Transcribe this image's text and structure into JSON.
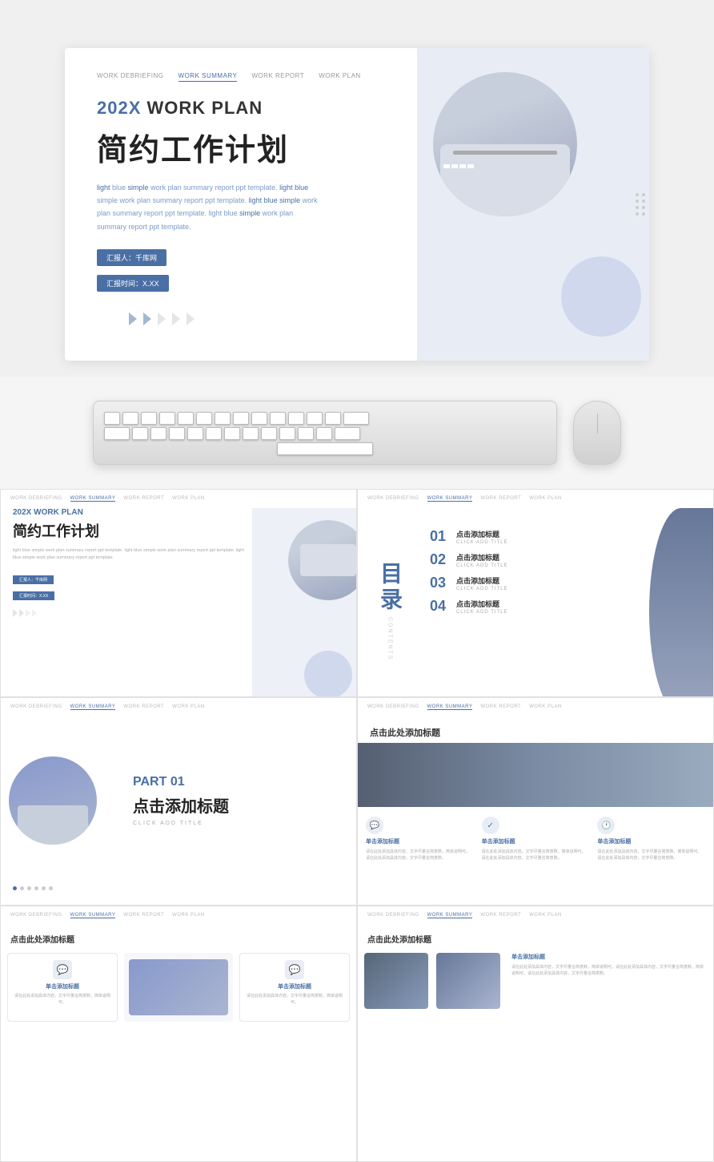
{
  "hero": {
    "nav": {
      "items": [
        "WORK DEBRIEFING",
        "WORK SUMMARY",
        "WORK REPORT",
        "WORK PLAN"
      ],
      "active": "WORK SUMMARY"
    },
    "title_en_prefix": "202X",
    "title_en_suffix": "WORK PLAN",
    "title_zh": "简约工作计划",
    "desc": "light blue simple work plan summary report ppt template. light blue simple work plan summary report ppt template. light blue simple work plan summary report ppt template. light blue simple work plan summary report ppt template.",
    "reporter_label": "汇报人：千库网",
    "time_label": "汇报时间：X.XX"
  },
  "toc": {
    "title_zh": "目录",
    "title_en": "CONTENTS",
    "items": [
      {
        "num": "01",
        "title": "点击添加标题",
        "sub": "CLICK ADD TITLE"
      },
      {
        "num": "02",
        "title": "点击添加标题",
        "sub": "CLICK ADD TITLE"
      },
      {
        "num": "03",
        "title": "点击添加标题",
        "sub": "CLICK ADD TITLE"
      },
      {
        "num": "04",
        "title": "点击添加标题",
        "sub": "CLICK ADD TITLE"
      }
    ]
  },
  "part": {
    "label": "PART 01",
    "title": "点击添加标题",
    "sub": "CLICK ADD TITLE"
  },
  "content_slide": {
    "header": "点击此处添加标题",
    "icons": [
      {
        "icon": "💬",
        "title": "单击添加标题",
        "desc": "请在此处添加具体内容，文字尽量言简意赅，简单说明可。请在此处添加具体内容，文字尽量言简意赅。"
      },
      {
        "icon": "✓",
        "title": "单击添加标题",
        "desc": "请在此处添加具体内容，文字尽量言简意赅，简单说明可。请在此处添加具体内容，文字尽量言简意赅。"
      },
      {
        "icon": "🕐",
        "title": "单击添加标题",
        "desc": "请在此处添加具体内容，文字尽量言简意赅，简单说明可。请在此处添加具体内容，文字尽量言简意赅。"
      }
    ]
  },
  "bottom_left": {
    "header": "点击此处添加标题",
    "cards": [
      {
        "icon": "💬",
        "title": "单击添加标题",
        "desc": "请在此处添加具体内容，文字尽量言简意赅，简单说明可。"
      },
      {
        "icon": "📷",
        "title": "",
        "desc": ""
      },
      {
        "icon": "💬",
        "title": "单击添加标题",
        "desc": "请在此处添加具体内容，文字尽量言简意赅，简单说明可。"
      }
    ]
  },
  "bottom_right": {
    "header": "点击此处添加标题",
    "right_title": "单击添加标题",
    "right_desc": "请在此处添加具体内容，文字尽量言简意赅，简单说明可。请在此处添加具体内容，文字尽量言简意赅。简单说明可。请在此处添加具体内容，文字尽量言简意赅。"
  },
  "colors": {
    "accent": "#4a6fa5",
    "light_blue": "#b8c5e0",
    "bg_slide": "#eef0f8"
  }
}
